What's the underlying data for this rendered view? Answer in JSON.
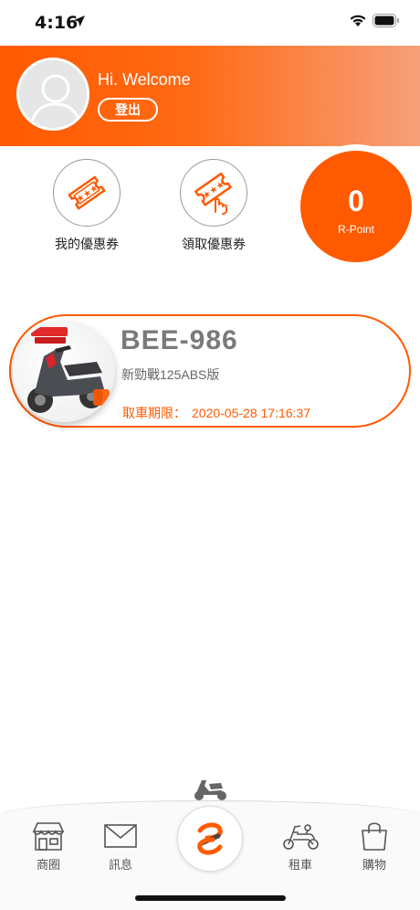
{
  "status_bar": {
    "time": "4:16",
    "icons": [
      "location-arrow-icon",
      "wifi-icon",
      "battery-icon"
    ]
  },
  "header": {
    "greeting": "Hi. Welcome",
    "logout_label": "登出",
    "avatar_icon": "user-avatar-icon",
    "gradient_colors": [
      "#ff5a00",
      "#f6a07a"
    ]
  },
  "coupons": [
    {
      "label": "我的優惠券",
      "icon": "ticket-icon"
    },
    {
      "label": "領取優惠券",
      "icon": "ticket-claim-icon"
    }
  ],
  "rpoint": {
    "value": "0",
    "label": "R-Point",
    "color": "#ff5a00"
  },
  "vehicle": {
    "plate": "BEE-986",
    "model": "新勁戰125ABS版",
    "deadline_label": "取車期限：",
    "deadline_value": "2020-05-28 17:16:37",
    "image_icon": "scooter-photo"
  },
  "bottom_nav": {
    "items": [
      {
        "label": "商圈",
        "icon": "shop-icon"
      },
      {
        "label": "訊息",
        "icon": "mail-icon"
      },
      {
        "label": "",
        "icon": "brand-logo-icon"
      },
      {
        "label": "租車",
        "icon": "scooter-icon"
      },
      {
        "label": "購物",
        "icon": "shopping-bag-icon"
      }
    ]
  },
  "accent_color": "#ff5a00"
}
